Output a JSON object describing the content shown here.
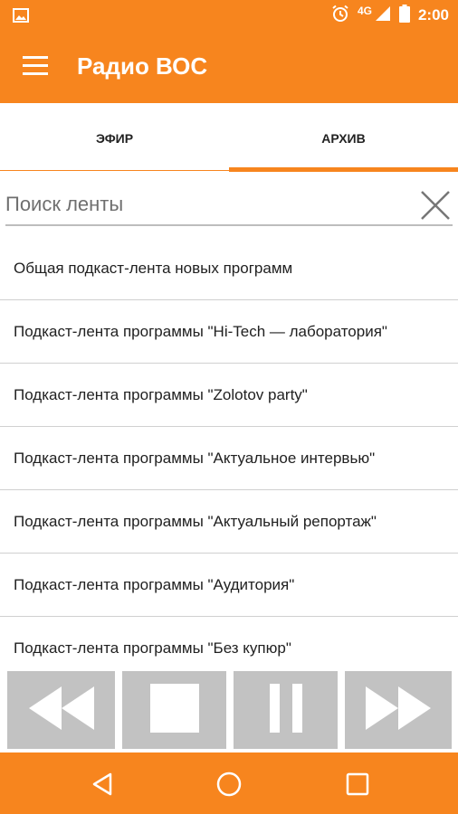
{
  "status_bar": {
    "network": "4G",
    "time": "2:00",
    "icons": [
      "image-icon",
      "alarm-icon",
      "signal-icon",
      "battery-icon"
    ]
  },
  "toolbar": {
    "title": "Радио ВОС",
    "menu_icon": "menu-icon"
  },
  "tabs": [
    {
      "label": "ЭФИР",
      "selected": false
    },
    {
      "label": "АРХИВ",
      "selected": true
    }
  ],
  "search": {
    "placeholder": "Поиск ленты",
    "value": "",
    "clear_icon": "close-icon"
  },
  "feeds": [
    "Общая подкаст-лента новых программ",
    "Подкаст-лента программы \"Hi-Tech — лаборатория\"",
    "Подкаст-лента программы \"Zolotov party\"",
    "Подкаст-лента программы \"Актуальное интервью\"",
    "Подкаст-лента программы \"Актуальный репортаж\"",
    "Подкаст-лента программы \"Аудитория\"",
    "Подкаст-лента программы \"Без купюр\""
  ],
  "player_controls": [
    "rewind-icon",
    "stop-icon",
    "pause-icon",
    "fast-forward-icon"
  ],
  "nav_bar": [
    "back-icon",
    "home-icon",
    "recents-icon"
  ],
  "colors": {
    "accent": "#f7851e",
    "control_bg": "#c2c2c2",
    "divider": "#d0d0d0"
  }
}
